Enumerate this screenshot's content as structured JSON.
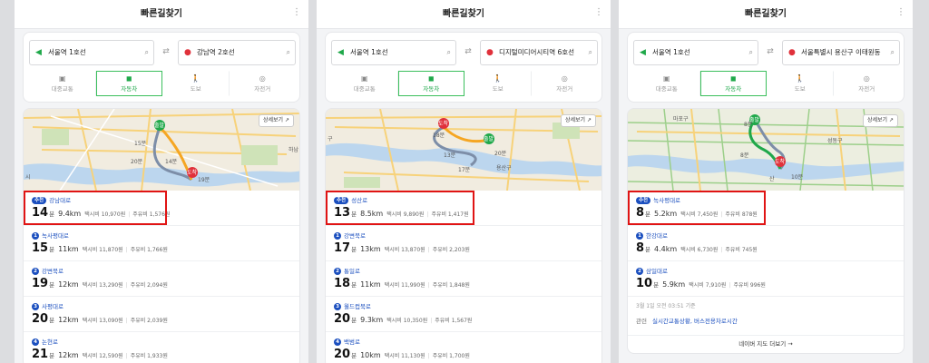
{
  "panels": [
    {
      "header_title": "빠른길찾기",
      "more_icon": "⋮",
      "origin": "서울역 1호선",
      "destination": "강남역 2호선",
      "modes": [
        {
          "icon": "bus-icon",
          "glyph": "▣",
          "label": "대중교통",
          "active": false
        },
        {
          "icon": "car-icon",
          "glyph": "◼",
          "label": "자동차",
          "active": true
        },
        {
          "icon": "walk-icon",
          "glyph": "🚶",
          "label": "도보",
          "active": false
        },
        {
          "icon": "bike-icon",
          "glyph": "◎",
          "label": "자전거",
          "active": false
        }
      ],
      "map_detail_label": "상세보기 ↗",
      "map_labels": [
        "하남",
        "시"
      ],
      "map_markers": [
        "출발",
        "도착"
      ],
      "map_times": [
        "15분",
        "20분",
        "14분",
        "19분"
      ],
      "routes": [
        {
          "tag": "추천",
          "name": "강남대로",
          "minutes": "14",
          "unit": "분",
          "distance": "9.4km",
          "taxi": "택시비 10,970원",
          "fuel": "주유비 1,576원"
        },
        {
          "tag": "1",
          "name": "녹사평대로",
          "minutes": "15",
          "unit": "분",
          "distance": "11km",
          "taxi": "택시비 11,870원",
          "fuel": "주유비 1,766원"
        },
        {
          "tag": "2",
          "name": "강변북로",
          "minutes": "19",
          "unit": "분",
          "distance": "12km",
          "taxi": "택시비 13,290원",
          "fuel": "주유비 2,094원"
        },
        {
          "tag": "3",
          "name": "사평대로",
          "minutes": "20",
          "unit": "분",
          "distance": "12km",
          "taxi": "택시비 13,090원",
          "fuel": "주유비 2,039원"
        },
        {
          "tag": "4",
          "name": "논현로",
          "minutes": "21",
          "unit": "분",
          "distance": "12km",
          "taxi": "택시비 12,590원",
          "fuel": "주유비 1,933원"
        }
      ]
    },
    {
      "header_title": "빠른길찾기",
      "more_icon": "⋮",
      "origin": "서울역 1호선",
      "destination": "디지털미디어시티역 6호선",
      "modes": [
        {
          "icon": "bus-icon",
          "glyph": "▣",
          "label": "대중교통",
          "active": false
        },
        {
          "icon": "car-icon",
          "glyph": "◼",
          "label": "자동차",
          "active": true
        },
        {
          "icon": "walk-icon",
          "glyph": "🚶",
          "label": "도보",
          "active": false
        },
        {
          "icon": "bike-icon",
          "glyph": "◎",
          "label": "자전거",
          "active": false
        }
      ],
      "map_detail_label": "상세보기 ↗",
      "map_labels": [
        "구",
        "용산구"
      ],
      "map_markers": [
        "도착",
        "출발"
      ],
      "map_times": [
        "18분",
        "13분",
        "20분",
        "17분"
      ],
      "routes": [
        {
          "tag": "추천",
          "name": "성산로",
          "minutes": "13",
          "unit": "분",
          "distance": "8.5km",
          "taxi": "택시비 9,890원",
          "fuel": "주유비 1,417원"
        },
        {
          "tag": "1",
          "name": "강변북로",
          "minutes": "17",
          "unit": "분",
          "distance": "13km",
          "taxi": "택시비 13,870원",
          "fuel": "주유비 2,203원"
        },
        {
          "tag": "2",
          "name": "통일로",
          "minutes": "18",
          "unit": "분",
          "distance": "11km",
          "taxi": "택시비 11,990원",
          "fuel": "주유비 1,848원"
        },
        {
          "tag": "3",
          "name": "월드컵북로",
          "minutes": "20",
          "unit": "분",
          "distance": "9.3km",
          "taxi": "택시비 10,350원",
          "fuel": "주유비 1,567원"
        },
        {
          "tag": "4",
          "name": "백범로",
          "minutes": "20",
          "unit": "분",
          "distance": "10km",
          "taxi": "택시비 11,130원",
          "fuel": "주유비 1,700원"
        }
      ]
    },
    {
      "header_title": "빠른길찾기",
      "more_icon": "⋮",
      "origin": "서울역 1호선",
      "destination": "서울특별시 용산구 이태원동",
      "modes": [
        {
          "icon": "bus-icon",
          "glyph": "▣",
          "label": "대중교통",
          "active": false
        },
        {
          "icon": "car-icon",
          "glyph": "◼",
          "label": "자동차",
          "active": true
        },
        {
          "icon": "walk-icon",
          "glyph": "🚶",
          "label": "도보",
          "active": false
        },
        {
          "icon": "bike-icon",
          "glyph": "◎",
          "label": "자전거",
          "active": false
        }
      ],
      "map_detail_label": "상세보기 ↗",
      "map_labels": [
        "마포구",
        "성동구",
        "산"
      ],
      "map_markers": [
        "출발",
        "도착"
      ],
      "map_times": [
        "8분",
        "10분",
        "8분"
      ],
      "routes": [
        {
          "tag": "추천",
          "name": "녹사평대로",
          "minutes": "8",
          "unit": "분",
          "distance": "5.2km",
          "taxi": "택시비 7,450원",
          "fuel": "주유비 878원"
        },
        {
          "tag": "1",
          "name": "한강대로",
          "minutes": "8",
          "unit": "분",
          "distance": "4.4km",
          "taxi": "택시비 6,730원",
          "fuel": "주유비 745원"
        },
        {
          "tag": "2",
          "name": "삼일대로",
          "minutes": "10",
          "unit": "분",
          "distance": "5.9km",
          "taxi": "택시비 7,910원",
          "fuel": "주유비 996원"
        }
      ],
      "timestamp": "3월 1일 오전 03:51 기준",
      "related_label": "관련",
      "related_links": "실시간교통상황, 버스전용차로시간",
      "more_link": "네이버 지도 더보기 →"
    }
  ],
  "colors": {
    "accent_green": "#1fa84a",
    "destination_red": "#e0313b",
    "route_blue": "#1b4fbf",
    "highlight": "#e01414"
  }
}
